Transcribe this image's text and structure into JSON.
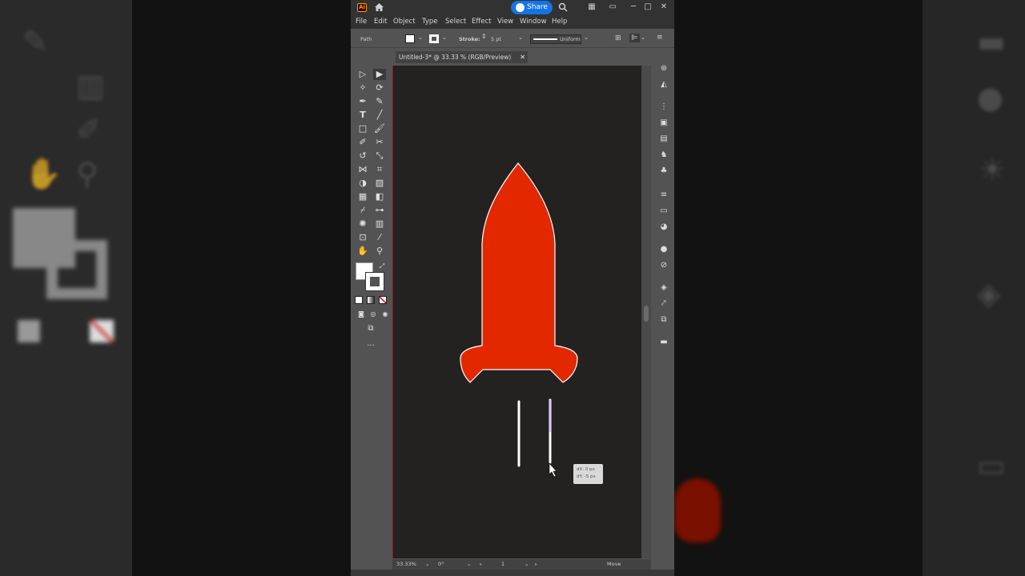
{
  "app": {
    "logo_text": "Ai",
    "share_label": "Share",
    "accent": "#1473e6"
  },
  "menu": [
    "File",
    "Edit",
    "Object",
    "Type",
    "Select",
    "Effect",
    "View",
    "Window",
    "Help"
  ],
  "control_bar": {
    "selection": "Path",
    "stroke_label": "Stroke:",
    "stroke_weight": "5 pt",
    "profile": "Uniform"
  },
  "document": {
    "tab_title": "Untitled-3* @ 33.33 % (RGB/Preview)"
  },
  "artwork": {
    "rocket_color": "#e32800",
    "stroke_color": "#ffffff",
    "line_selected_color": "#b88cf5"
  },
  "tooltip": {
    "dx": "dX: 0 px",
    "dy": "dY: -5 px"
  },
  "status_bar": {
    "zoom": "33.33%",
    "rotation": "0°",
    "artboard_num": "1",
    "tool_name": "Move"
  }
}
